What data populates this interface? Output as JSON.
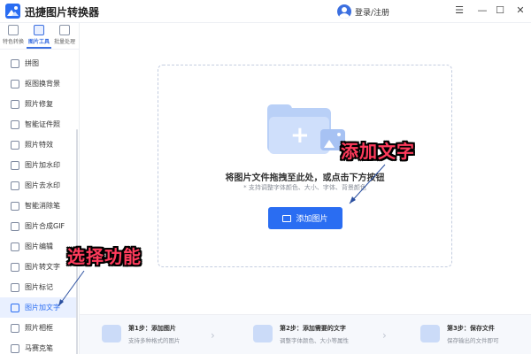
{
  "app": {
    "title": "迅捷图片转换器",
    "login": "登录/注册"
  },
  "window_controls": {
    "menu": "☰",
    "minimize": "—",
    "maximize": "☐",
    "close": "✕"
  },
  "topnav": [
    {
      "label": "特色转换",
      "icon": "star-icon",
      "active": false
    },
    {
      "label": "图片工具",
      "icon": "image-tools-icon",
      "active": true
    },
    {
      "label": "批量处理",
      "icon": "batch-icon",
      "active": false
    }
  ],
  "menu": [
    {
      "label": "拼图",
      "active": false
    },
    {
      "label": "抠图换背景",
      "active": false
    },
    {
      "label": "照片修复",
      "active": false
    },
    {
      "label": "智能证件照",
      "active": false
    },
    {
      "label": "照片特效",
      "active": false
    },
    {
      "label": "图片加水印",
      "active": false
    },
    {
      "label": "图片去水印",
      "active": false
    },
    {
      "label": "智能消除笔",
      "active": false
    },
    {
      "label": "图片合成GIF",
      "active": false
    },
    {
      "label": "图片编辑",
      "active": false
    },
    {
      "label": "图片转文字",
      "active": false
    },
    {
      "label": "图片标记",
      "active": false
    },
    {
      "label": "图片加文字",
      "active": true
    },
    {
      "label": "照片相框",
      "active": false
    },
    {
      "label": "马赛克笔",
      "active": false
    }
  ],
  "dropzone": {
    "title": "将图片文件拖拽至此处，或点击下方按钮",
    "hint": "* 支持调整字体颜色、大小、字体、背景颜色",
    "button": "添加图片"
  },
  "annotations": {
    "top": "添加文字",
    "left": "选择功能"
  },
  "steps": [
    {
      "title": "第1步：添加图片",
      "desc": "支持多种格式的图片"
    },
    {
      "title": "第2步：添加需要的文字",
      "desc": "调整字体颜色、大小等属性"
    },
    {
      "title": "第3步：保存文件",
      "desc": "保存输出的文件即可"
    }
  ],
  "colors": {
    "accent": "#2a6df2",
    "annotation": "#ff3b5c"
  }
}
